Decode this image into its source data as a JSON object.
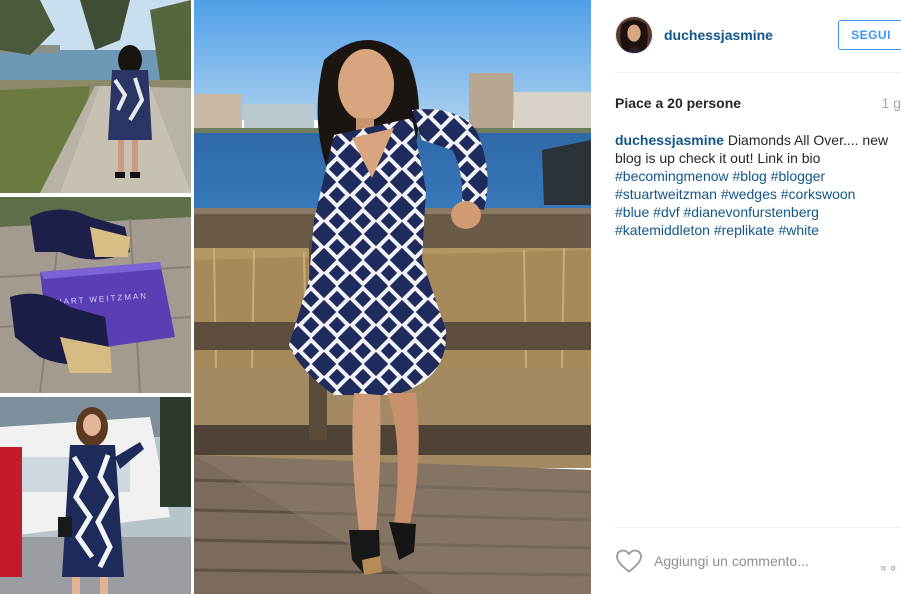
{
  "post": {
    "username": "duchessjasmine",
    "follow_label": "SEGUI",
    "likes_text": "Piace a 20 persone",
    "time_ago": "1 g",
    "caption": {
      "author": "duchessjasmine",
      "text": "Diamonds All Over.... new blog is up check it out! Link in bio",
      "hashtags": [
        "#becomingmenow",
        "#blog",
        "#blogger",
        "#stuartweitzman",
        "#wedges",
        "#corkswoon",
        "#blue",
        "#dvf",
        "#dianevonfurstenberg",
        "#katemiddleton",
        "#replikate",
        "#white"
      ]
    },
    "comment_placeholder": "Aggiungi un commento...",
    "more_label": "∘∘∘"
  },
  "media": {
    "shoebox_brand": "STUART WEITZMAN"
  },
  "icons": {
    "like": "heart-outline-icon",
    "more": "more-options-icon"
  },
  "colors": {
    "link": "#125688",
    "follow_blue": "#3897f0",
    "muted": "#a5a7aa",
    "dress_navy": "#1e2a55"
  }
}
